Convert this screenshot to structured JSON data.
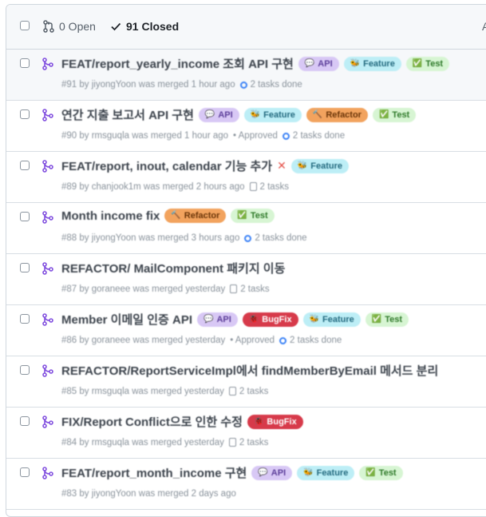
{
  "header": {
    "open_label": "0 Open",
    "closed_label": "91 Closed",
    "cut_text": "A"
  },
  "pull_requests": [
    {
      "title": "FEAT/report_yearly_income 조회 API 구현",
      "labels": [
        {
          "text": "API",
          "emoji": "💬",
          "bg": "#d8c8f5",
          "fg": "#5b3d99"
        },
        {
          "text": "Feature",
          "emoji": "🐝",
          "bg": "#bdeef6",
          "fg": "#246b80"
        },
        {
          "text": "Test",
          "emoji": "✅",
          "bg": "#d7f5d3",
          "fg": "#2f7a2a"
        }
      ],
      "meta": "#91 by jiyongYoon was merged 1 hour ago",
      "approved": "",
      "tasks": "2 tasks done",
      "tasks_type": "done",
      "error_mark": ""
    },
    {
      "title": "연간 지출 보고서 API 구현",
      "labels": [
        {
          "text": "API",
          "emoji": "💬",
          "bg": "#d8c8f5",
          "fg": "#5b3d99"
        },
        {
          "text": "Feature",
          "emoji": "🐝",
          "bg": "#bdeef6",
          "fg": "#246b80"
        },
        {
          "text": "Refactor",
          "emoji": "🔨",
          "bg": "#f2a35e",
          "fg": "#6b3508"
        },
        {
          "text": "Test",
          "emoji": "✅",
          "bg": "#d7f5d3",
          "fg": "#2f7a2a"
        }
      ],
      "meta": "#90 by rmsguqla was merged 1 hour ago",
      "approved": "• Approved",
      "tasks": "2 tasks done",
      "tasks_type": "done",
      "error_mark": ""
    },
    {
      "title": "FEAT/report, inout, calendar 기능 추가",
      "labels": [
        {
          "text": "Feature",
          "emoji": "🐝",
          "bg": "#bdeef6",
          "fg": "#246b80"
        }
      ],
      "meta": "#89 by chanjook1m was merged 2 hours ago",
      "approved": "",
      "tasks": "2 tasks",
      "tasks_type": "plain",
      "error_mark": "✕"
    },
    {
      "title": "Month income fix",
      "labels": [
        {
          "text": "Refactor",
          "emoji": "🔨",
          "bg": "#f2a35e",
          "fg": "#6b3508"
        },
        {
          "text": "Test",
          "emoji": "✅",
          "bg": "#d7f5d3",
          "fg": "#2f7a2a"
        }
      ],
      "meta": "#88 by jiyongYoon was merged 3 hours ago",
      "approved": "",
      "tasks": "2 tasks done",
      "tasks_type": "done",
      "error_mark": ""
    },
    {
      "title": "REFACTOR/ MailComponent 패키지 이동",
      "labels": [],
      "meta": "#87 by goraneee was merged yesterday",
      "approved": "",
      "tasks": "2 tasks",
      "tasks_type": "plain",
      "error_mark": ""
    },
    {
      "title": "Member 이메일 인증 API",
      "labels": [
        {
          "text": "API",
          "emoji": "💬",
          "bg": "#d8c8f5",
          "fg": "#5b3d99"
        },
        {
          "text": "BugFix",
          "emoji": "🐞",
          "bg": "#d73a4a",
          "fg": "#ffffff"
        },
        {
          "text": "Feature",
          "emoji": "🐝",
          "bg": "#bdeef6",
          "fg": "#246b80"
        },
        {
          "text": "Test",
          "emoji": "✅",
          "bg": "#d7f5d3",
          "fg": "#2f7a2a"
        }
      ],
      "meta": "#86 by goraneee was merged yesterday",
      "approved": "• Approved",
      "tasks": "2 tasks done",
      "tasks_type": "done",
      "error_mark": ""
    },
    {
      "title": "REFACTOR/ReportServiceImpl에서 findMemberByEmail 메서드 분리",
      "labels": [],
      "meta": "#85 by rmsguqla was merged yesterday",
      "approved": "",
      "tasks": "2 tasks",
      "tasks_type": "plain",
      "error_mark": ""
    },
    {
      "title": "FIX/Report Conflict으로 인한 수정",
      "labels": [
        {
          "text": "BugFix",
          "emoji": "🐞",
          "bg": "#d73a4a",
          "fg": "#ffffff"
        }
      ],
      "meta": "#84 by rmsguqla was merged yesterday",
      "approved": "",
      "tasks": "2 tasks",
      "tasks_type": "plain",
      "error_mark": ""
    },
    {
      "title": "FEAT/report_month_income 구현",
      "labels": [
        {
          "text": "API",
          "emoji": "💬",
          "bg": "#d8c8f5",
          "fg": "#5b3d99"
        },
        {
          "text": "Feature",
          "emoji": "🐝",
          "bg": "#bdeef6",
          "fg": "#246b80"
        },
        {
          "text": "Test",
          "emoji": "✅",
          "bg": "#d7f5d3",
          "fg": "#2f7a2a"
        }
      ],
      "meta": "#83 by jiyongYoon was merged 2 days ago",
      "approved": "",
      "tasks": "",
      "tasks_type": "none",
      "error_mark": ""
    }
  ]
}
